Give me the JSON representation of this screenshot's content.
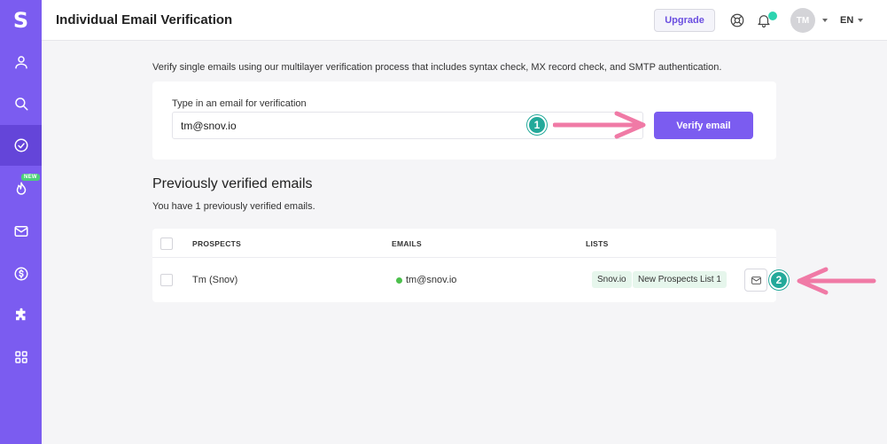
{
  "app": {
    "logo_letter": "S"
  },
  "sidebar": {
    "items": [
      {
        "icon": "user-icon"
      },
      {
        "icon": "search-icon"
      },
      {
        "icon": "check-circle-icon",
        "active": true
      },
      {
        "icon": "flame-icon",
        "badge": "NEW"
      },
      {
        "icon": "mail-icon"
      },
      {
        "icon": "dollar-circle-icon"
      },
      {
        "icon": "puzzle-icon"
      },
      {
        "icon": "grid-icon"
      }
    ]
  },
  "header": {
    "title": "Individual Email Verification",
    "upgrade_label": "Upgrade",
    "avatar_initials": "TM",
    "language": "EN"
  },
  "intro": "Verify single emails using our multilayer verification process that includes syntax check, MX record check, and SMTP authentication.",
  "verify_form": {
    "label": "Type in an email for verification",
    "input_value": "tm@snov.io",
    "button_label": "Verify email"
  },
  "history": {
    "title": "Previously verified emails",
    "count_text": "You have 1 previously verified emails.",
    "columns": {
      "prospects": "PROSPECTS",
      "emails": "EMAILS",
      "lists": "LISTS"
    },
    "rows": [
      {
        "prospect": "Tm (Snov)",
        "email": "tm@snov.io",
        "status_color": "#4cc04c",
        "lists": [
          "Snov.io",
          "New Prospects List 1"
        ]
      }
    ]
  },
  "annotations": {
    "step1": "1",
    "step2": "2",
    "arrow_color": "#f07aa6",
    "marker_color": "#23a99a"
  },
  "colors": {
    "brand": "#7b5cf0",
    "sidebar_active": "#6445d9",
    "tag_bg": "#e6f6ec"
  }
}
